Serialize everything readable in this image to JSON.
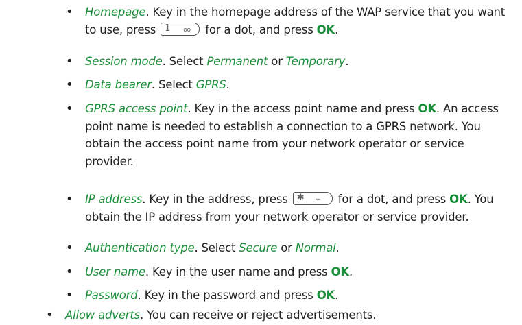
{
  "items": [
    {
      "term": "Homepage",
      "line1": ". Key in the homepage address of the WAP service that you want",
      "line2a": "to use, press ",
      "key": {
        "main": "1",
        "sub": "oo"
      },
      "line2b": " for a dot, and press ",
      "ok": "OK",
      "line2c": "."
    },
    {
      "term": "Session mode",
      "text1": ". Select ",
      "opt1": "Permanent",
      "text2": " or ",
      "opt2": "Temporary",
      "text3": "."
    },
    {
      "term": "Data bearer",
      "text1": ". Select ",
      "opt1": "GPRS",
      "text2": "."
    },
    {
      "term": "GPRS access point",
      "line1a": ". Key in the access point name and press ",
      "ok": "OK",
      "line1b": ". An access",
      "line2": "point name is needed to establish a connection to a GPRS network. You",
      "line3": "obtain the access point name from your network operator or service",
      "line4": "provider."
    },
    {
      "term": "IP address",
      "line1a": ". Key in the address, press ",
      "key": {
        "main": "✱",
        "sub": "+"
      },
      "line1b": " for a dot, and press ",
      "ok": "OK",
      "line1c": ". You",
      "line2": "obtain the IP address from your network operator or service provider."
    },
    {
      "term": "Authentication type",
      "text1": ". Select ",
      "opt1": "Secure",
      "text2": " or ",
      "opt2": "Normal",
      "text3": "."
    },
    {
      "term": "User name",
      "text1": ". Key in the user name and press ",
      "ok": "OK",
      "text2": "."
    },
    {
      "term": "Password",
      "text1": ". Key in the password and press ",
      "ok": "OK",
      "text2": "."
    },
    {
      "term": "Allow adverts",
      "text1": ". You can receive or reject advertisements."
    }
  ],
  "bullet": "•"
}
